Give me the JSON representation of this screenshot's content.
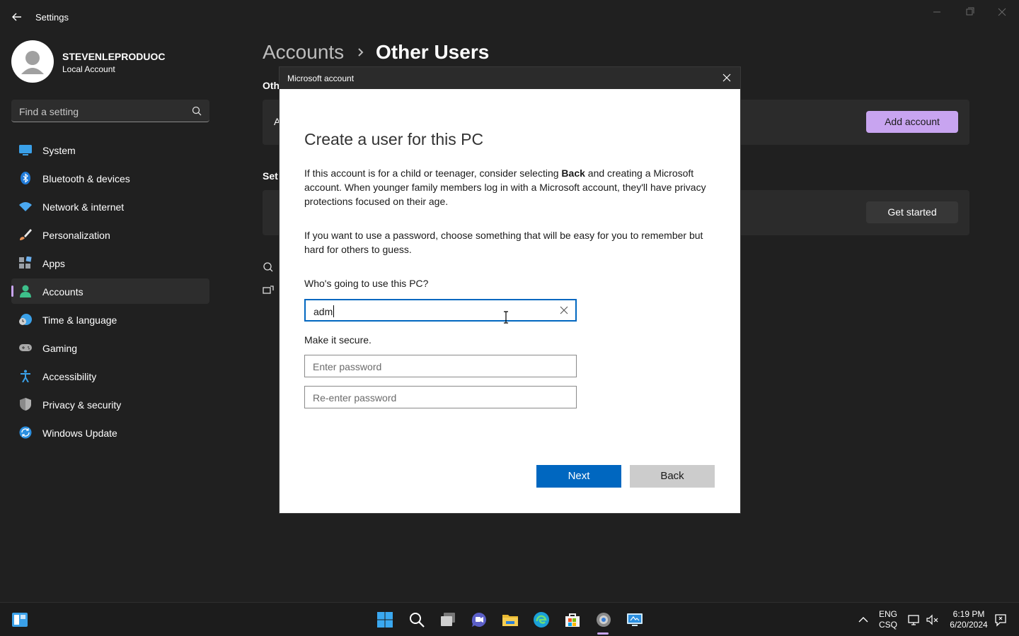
{
  "app": {
    "title": "Settings"
  },
  "profile": {
    "name": "STEVENLEPRODUOC",
    "account_type": "Local Account"
  },
  "search": {
    "placeholder": "Find a setting"
  },
  "sidebar": {
    "items": [
      {
        "label": "System",
        "icon": "system-icon"
      },
      {
        "label": "Bluetooth & devices",
        "icon": "bluetooth-icon"
      },
      {
        "label": "Network & internet",
        "icon": "wifi-icon"
      },
      {
        "label": "Personalization",
        "icon": "brush-icon"
      },
      {
        "label": "Apps",
        "icon": "apps-icon"
      },
      {
        "label": "Accounts",
        "icon": "person-icon",
        "active": true
      },
      {
        "label": "Time & language",
        "icon": "clock-globe-icon"
      },
      {
        "label": "Gaming",
        "icon": "gamepad-icon"
      },
      {
        "label": "Accessibility",
        "icon": "accessibility-icon"
      },
      {
        "label": "Privacy & security",
        "icon": "shield-icon"
      },
      {
        "label": "Windows Update",
        "icon": "update-icon"
      }
    ]
  },
  "breadcrumb": {
    "parent": "Accounts",
    "current": "Other Users"
  },
  "background": {
    "section1_peek": "Oth",
    "section2_peek": "Set",
    "card1_peek": "A",
    "add_account_label": "Add account",
    "get_started_label": "Get started"
  },
  "dialog": {
    "title": "Microsoft account",
    "heading": "Create a user for this PC",
    "para1_before": "If this account is for a child or teenager, consider selecting ",
    "para1_bold": "Back",
    "para1_after": " and creating a Microsoft account. When younger family members log in with a Microsoft account, they'll have privacy protections focused on their age.",
    "para2": "If you want to use a password, choose something that will be easy for you to remember but hard for others to guess.",
    "who_label": "Who's going to use this PC?",
    "username_value": "adm",
    "secure_label": "Make it secure.",
    "password_placeholder": "Enter password",
    "reenter_placeholder": "Re-enter password",
    "next_label": "Next",
    "back_label": "Back"
  },
  "taskbar": {
    "apps": [
      "start-icon",
      "search-icon",
      "task-view-icon",
      "chat-icon",
      "file-explorer-icon",
      "edge-icon",
      "store-icon",
      "settings-icon",
      "remote-desktop-icon"
    ],
    "lang_line1": "ENG",
    "lang_line2": "CSQ",
    "time": "6:19 PM",
    "date": "6/20/2024"
  },
  "colors": {
    "accent": "#c8a4f0",
    "primary_button": "#0067c0",
    "background": "#202020"
  }
}
